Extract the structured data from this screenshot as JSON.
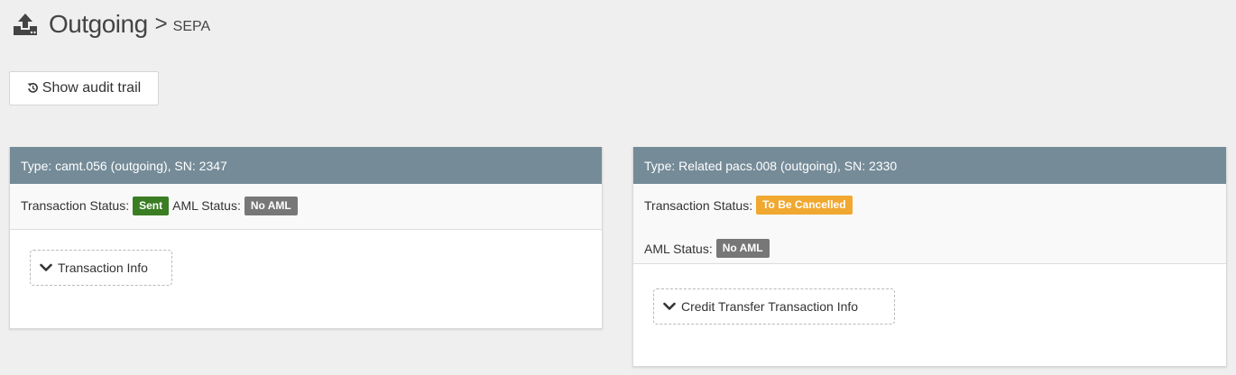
{
  "header": {
    "icon": "upload-icon",
    "title": "Outgoing",
    "separator": ">",
    "subtitle": "SEPA"
  },
  "toolbar": {
    "audit_icon": "history-icon",
    "audit_label": "Show audit trail"
  },
  "panels": [
    {
      "heading": "Type: camt.056 (outgoing), SN: 2347",
      "transaction_status_label": "Transaction Status:",
      "transaction_status": "Sent",
      "aml_status_label": "AML Status:",
      "aml_status": "No AML",
      "expand_label": "Transaction Info"
    },
    {
      "heading": "Type: Related pacs.008 (outgoing), SN: 2330",
      "transaction_status_label": "Transaction Status:",
      "transaction_status": "To Be Cancelled",
      "aml_status_label": "AML Status:",
      "aml_status": "No AML",
      "expand_label": "Credit Transfer Transaction Info"
    }
  ],
  "colors": {
    "panel_heading": "#758b98",
    "status_sent": "#3a7d23",
    "status_to_be_cancelled": "#f0a830",
    "status_no_aml": "#777777",
    "background": "#efefef"
  }
}
